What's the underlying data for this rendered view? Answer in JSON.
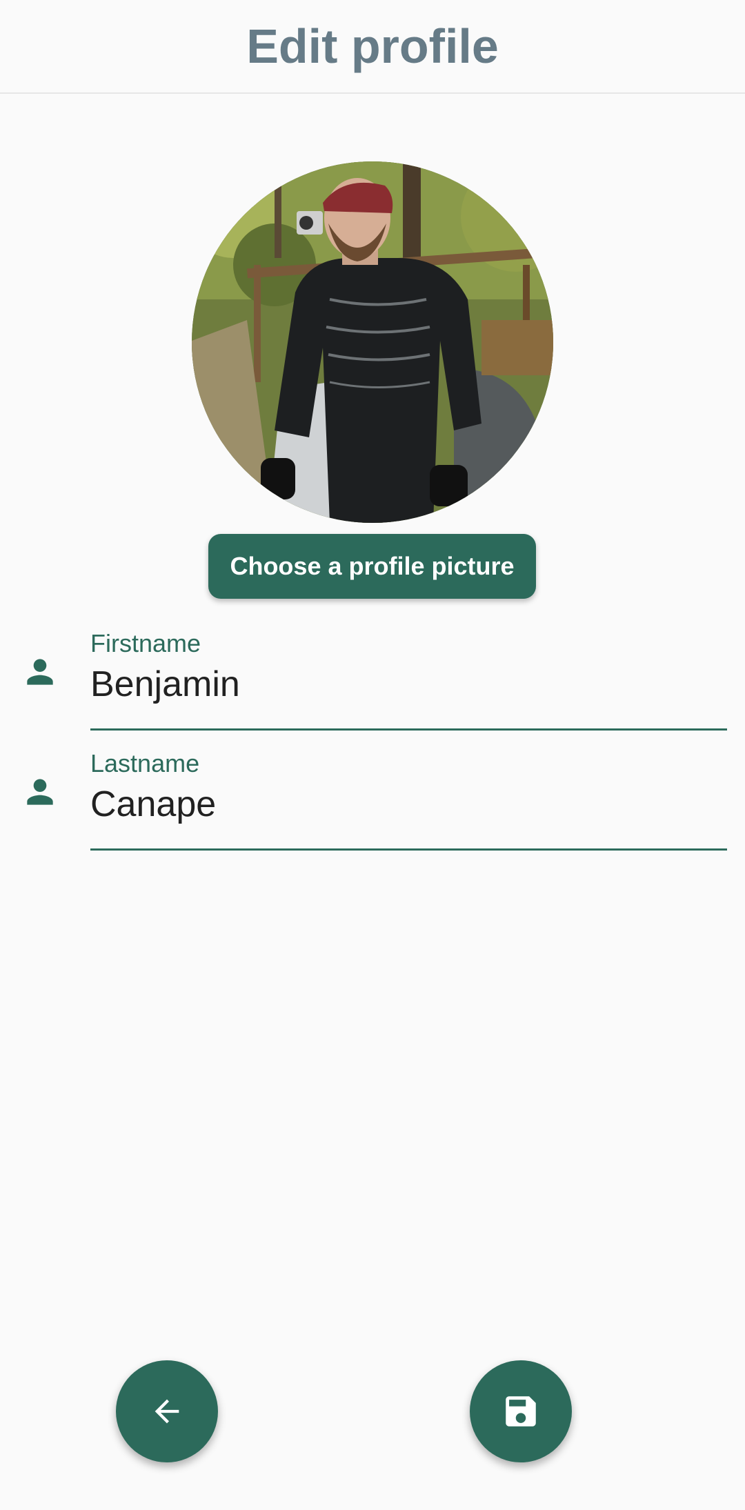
{
  "header": {
    "title": "Edit profile"
  },
  "avatar": {
    "icon": "profile-photo"
  },
  "choose_picture_button": {
    "label": "Choose a profile picture"
  },
  "fields": {
    "firstname": {
      "label": "Firstname",
      "value": "Benjamin",
      "icon": "person-icon"
    },
    "lastname": {
      "label": "Lastname",
      "value": "Canape",
      "icon": "person-icon"
    }
  },
  "actions": {
    "back_icon": "arrow-left-icon",
    "save_icon": "save-icon"
  },
  "colors": {
    "primary": "#2c6a5b",
    "title": "#667b87",
    "background": "#fafafa"
  }
}
